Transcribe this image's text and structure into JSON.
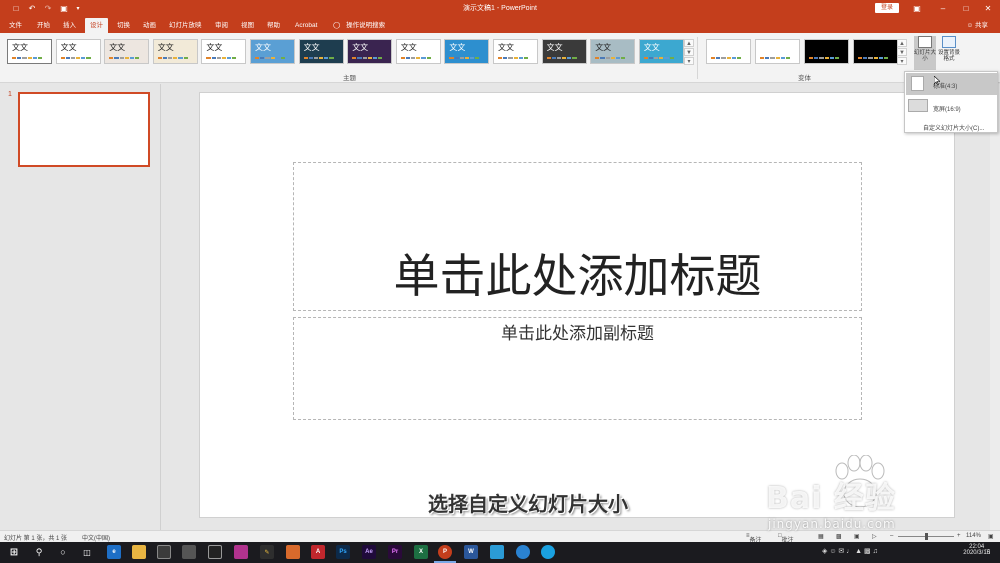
{
  "titlebar": {
    "document_title": "演示文稿1 - PowerPoint",
    "login": "登录",
    "save_icon": "save-icon",
    "undo_icon": "undo-icon",
    "redo_icon": "redo-icon"
  },
  "tabs": [
    {
      "label": "文件"
    },
    {
      "label": "开始"
    },
    {
      "label": "插入"
    },
    {
      "label": "设计"
    },
    {
      "label": "切换"
    },
    {
      "label": "动画"
    },
    {
      "label": "幻灯片放映"
    },
    {
      "label": "审阅"
    },
    {
      "label": "视图"
    },
    {
      "label": "帮助"
    },
    {
      "label": "Acrobat"
    }
  ],
  "search_label": "操作说明搜索",
  "share_label": "共享",
  "ribbon": {
    "theme_text": "文文",
    "themes_group_label": "主题",
    "variants_group_label": "变体",
    "slide_size_label": "幻灯片大小",
    "format_bg_label": "设置背景格式",
    "theme_colors": [
      "#ffffff",
      "#ffffff",
      "#ede6e0",
      "#f2ead8",
      "#ffffff",
      "#5a9fd4",
      "#1e3d4f",
      "#3a2450",
      "#ffffff",
      "#2d8fcf",
      "#ffffff",
      "#3a3a3a",
      "#a8bcc4",
      "#3ca8d0"
    ],
    "variant_colors": [
      "#ffffff",
      "#ffffff",
      "#000000",
      "#000000"
    ]
  },
  "dropdown": {
    "standard": "标准(4:3)",
    "widescreen": "宽屏(16:9)",
    "custom": "自定义幻灯片大小(C)..."
  },
  "thumbnail": {
    "number": "1"
  },
  "slide": {
    "title_placeholder": "单击此处添加标题",
    "subtitle_placeholder": "单击此处添加副标题"
  },
  "caption": "选择自定义幻灯片大小",
  "watermark": {
    "logo_text": "Bai 经验",
    "url": "jingyan.baidu.com"
  },
  "statusbar": {
    "slide_info": "幻灯片 第 1 张，共 1 张",
    "language": "中文(中国)",
    "notes": "备注",
    "comments": "批注",
    "zoom": "114%"
  },
  "taskbar": {
    "time": "22:04",
    "date": "2020/3/16"
  }
}
